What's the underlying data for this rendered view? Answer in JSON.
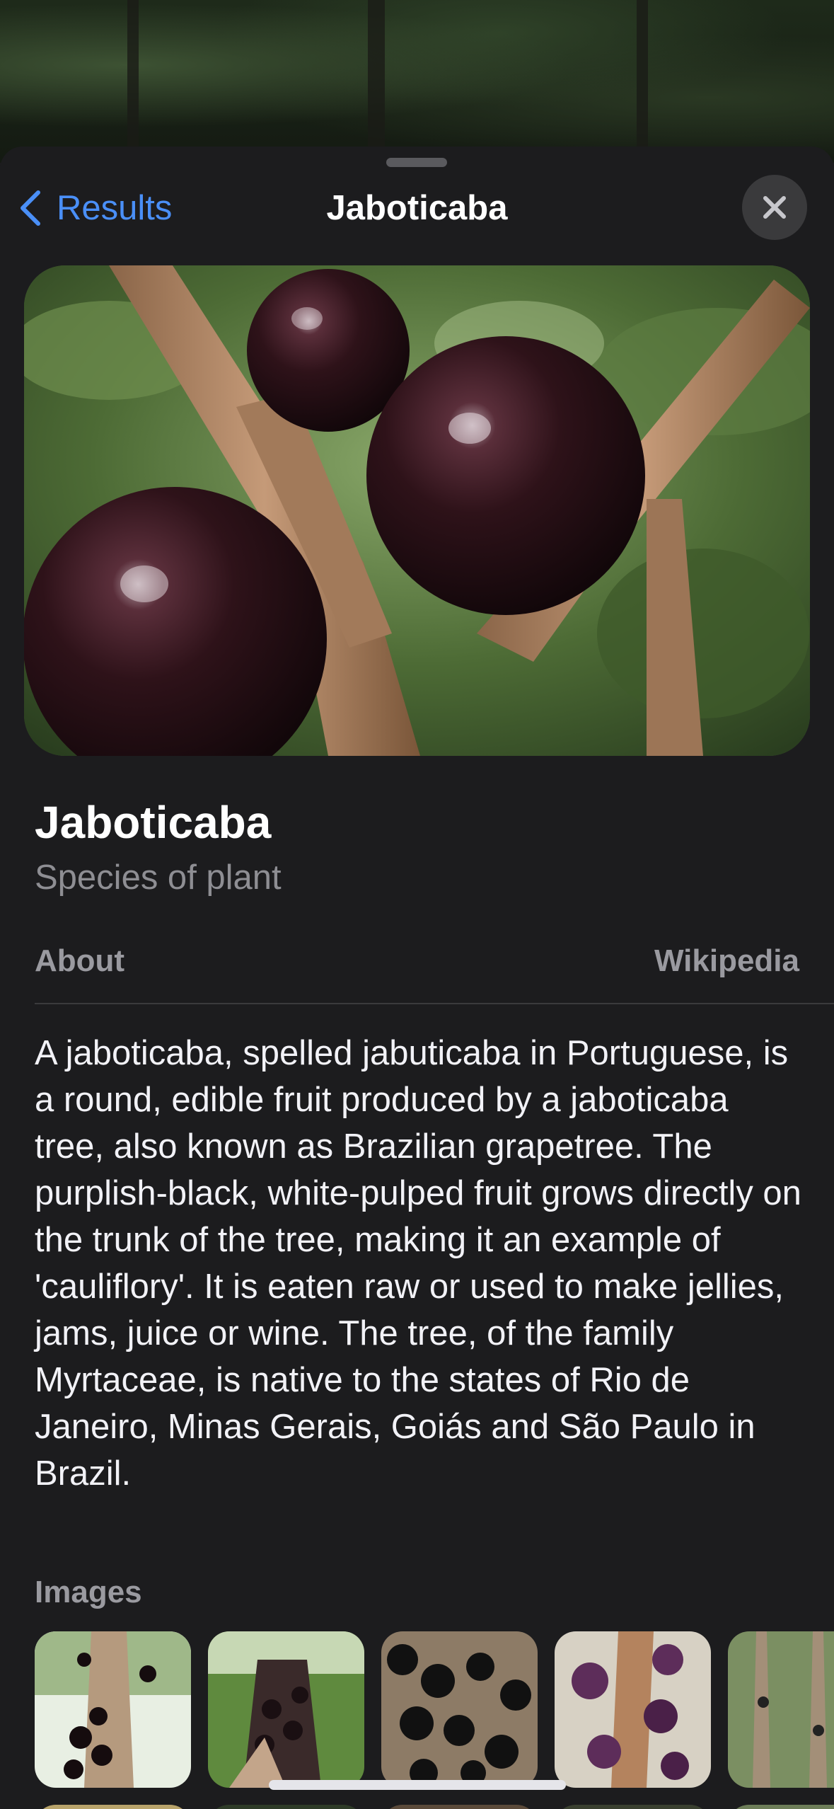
{
  "nav": {
    "back_label": "Results",
    "title": "Jaboticaba"
  },
  "header": {
    "title": "Jaboticaba",
    "subtitle": "Species of plant"
  },
  "about": {
    "heading": "About",
    "source": "Wikipedia",
    "text": "A jaboticaba, spelled jabuticaba in Portuguese, is a round, edible fruit produced by a jaboticaba tree, also known as Brazilian grapetree. The purplish-black, white-pulped fruit grows directly on the trunk of the tree, making it an example of 'cauliflory'. It is eaten raw or used to make jellies, jams, juice or wine. The tree, of the family Myrtaceae, is native to the states of Rio de Janeiro, Minas Gerais, Goiás and São Paulo in Brazil."
  },
  "images": {
    "heading": "Images"
  },
  "colors": {
    "accent": "#4a8ff7",
    "sheet_background": "#1c1c1e",
    "secondary_text": "#8e8e93"
  }
}
